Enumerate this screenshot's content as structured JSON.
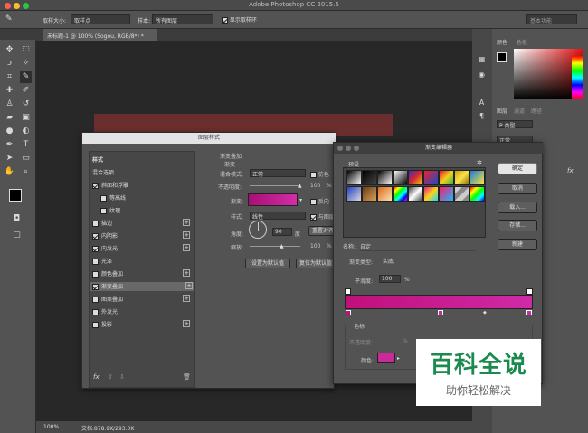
{
  "app": {
    "title": "Adobe Photoshop CC 2015.5"
  },
  "options": {
    "sample_size_label": "取样大小:",
    "sample_size_value": "取样点",
    "sample_label": "样本:",
    "sample_value": "所有图层",
    "show_ring_label": "显示取样环",
    "workspace": "基本功能"
  },
  "document": {
    "tab": "未标题-1 @ 100% (Sogou, RGB/8*) *",
    "zoom": "100%",
    "file_info": "文档:878.9K/293.0K"
  },
  "right": {
    "color_tab": "颜色",
    "swatches_tab": "色板",
    "layers_tab": "图层",
    "channels_tab": "通道",
    "paths_tab": "路径",
    "kind_label": "P 类型",
    "mode": "正常",
    "fx": "fx"
  },
  "layer_style": {
    "title": "图层样式",
    "styles_header": "样式",
    "blend_options": "混合选项",
    "items": [
      {
        "label": "斜面和浮雕",
        "checked": true
      },
      {
        "label": "等高线",
        "checked": false
      },
      {
        "label": "纹理",
        "checked": false
      },
      {
        "label": "描边",
        "checked": false
      },
      {
        "label": "内阴影",
        "checked": true
      },
      {
        "label": "内发光",
        "checked": true
      },
      {
        "label": "光泽",
        "checked": false
      },
      {
        "label": "颜色叠加",
        "checked": false
      },
      {
        "label": "渐变叠加",
        "checked": true
      },
      {
        "label": "图案叠加",
        "checked": false
      },
      {
        "label": "外发光",
        "checked": false
      },
      {
        "label": "投影",
        "checked": false
      }
    ],
    "section_title": "渐变叠加",
    "section_sub": "渐变",
    "blend_mode_label": "混合模式:",
    "blend_mode_value": "正常",
    "dither_label": "仿色",
    "opacity_label": "不透明度:",
    "opacity_value": "100",
    "opacity_unit": "%",
    "gradient_label": "渐变:",
    "reverse_label": "反向",
    "style_label": "样式:",
    "style_value": "线性",
    "align_label": "与图层",
    "angle_label": "角度:",
    "angle_value": "90",
    "angle_unit": "度",
    "reset_align": "重置对齐",
    "scale_label": "缩放:",
    "scale_value": "100",
    "scale_unit": "%",
    "make_default": "设置为默认值",
    "reset_default": "复位为默认值",
    "fx": "fx"
  },
  "gradient_editor": {
    "title": "渐变编辑器",
    "presets_label": "预设",
    "ok": "确定",
    "cancel": "取消",
    "load": "载入...",
    "save": "存储...",
    "name_label": "名称:",
    "name_value": "自定",
    "new_button": "新建",
    "type_label": "渐变类型:",
    "type_value": "实底",
    "smooth_label": "平滑度:",
    "smooth_value": "100",
    "smooth_unit": "%",
    "stops_label": "色标",
    "opacity_label": "不透明度:",
    "opacity_unit": "%",
    "color_label": "颜色:",
    "color_swatch": "#c82a9a",
    "gradient_from": "#c0107a",
    "gradient_to": "#d02aa8"
  },
  "watermark": {
    "main": "百科全说",
    "sub": "助你轻松解决"
  }
}
